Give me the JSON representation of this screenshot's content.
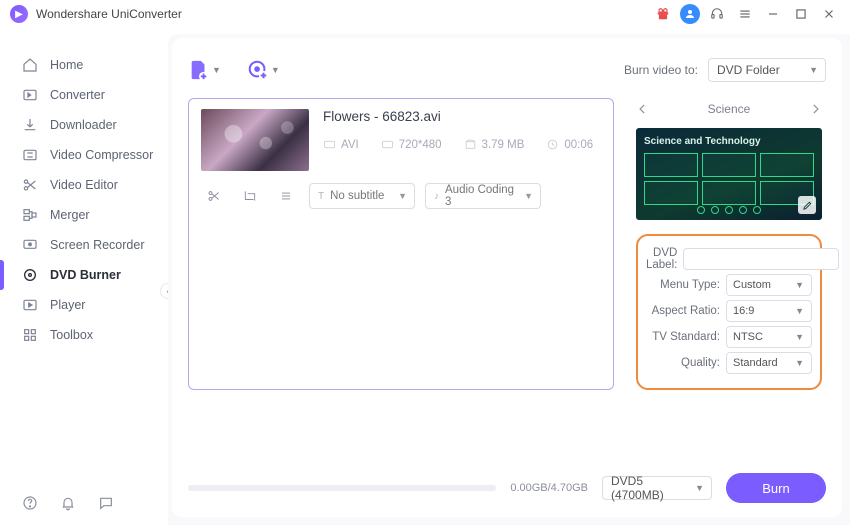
{
  "app": {
    "title": "Wondershare UniConverter"
  },
  "sidebar": {
    "items": [
      {
        "label": "Home"
      },
      {
        "label": "Converter"
      },
      {
        "label": "Downloader"
      },
      {
        "label": "Video Compressor"
      },
      {
        "label": "Video Editor"
      },
      {
        "label": "Merger"
      },
      {
        "label": "Screen Recorder"
      },
      {
        "label": "DVD Burner"
      },
      {
        "label": "Player"
      },
      {
        "label": "Toolbox"
      }
    ]
  },
  "burn_to": {
    "label": "Burn video to:",
    "value": "DVD Folder"
  },
  "video": {
    "title": "Flowers - 66823.avi",
    "format": "AVI",
    "resolution": "720*480",
    "size": "3.79 MB",
    "duration": "00:06",
    "subtitle": "No subtitle",
    "audio": "Audio Coding 3"
  },
  "template": {
    "name": "Science",
    "preview_title": "Science and Technology"
  },
  "settings": {
    "dvd_label_lbl": "DVD Label:",
    "dvd_label_val": "",
    "menu_type_lbl": "Menu Type:",
    "menu_type_val": "Custom",
    "aspect_lbl": "Aspect Ratio:",
    "aspect_val": "16:9",
    "tv_lbl": "TV Standard:",
    "tv_val": "NTSC",
    "quality_lbl": "Quality:",
    "quality_val": "Standard"
  },
  "footer": {
    "progress_text": "0.00GB/4.70GB",
    "disc_select": "DVD5 (4700MB)",
    "burn_label": "Burn"
  }
}
